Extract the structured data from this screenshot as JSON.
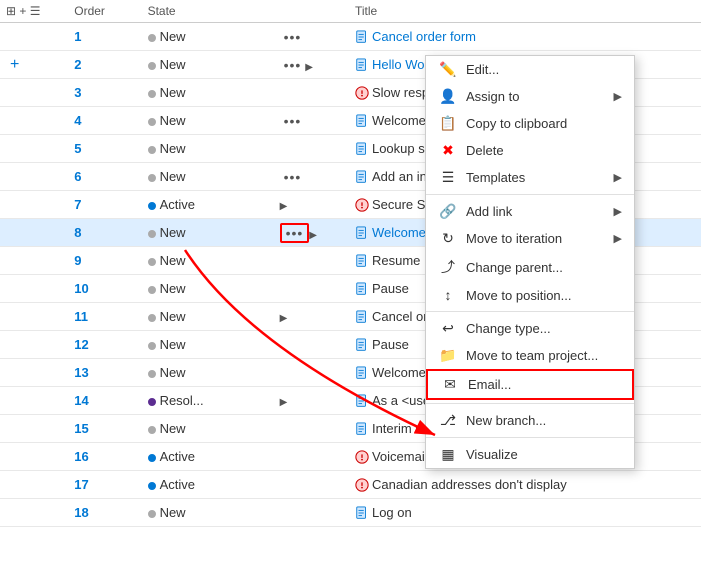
{
  "columns": [
    "",
    "Order",
    "State",
    "",
    "Title"
  ],
  "rows": [
    {
      "id": 1,
      "order": 1,
      "state": "New",
      "stateType": "new",
      "hasDots": true,
      "hasArrow": false,
      "hasChild": false,
      "iconType": "book",
      "title": "Cancel order form",
      "titleLink": true
    },
    {
      "id": 2,
      "order": 2,
      "state": "New",
      "stateType": "new",
      "hasDots": true,
      "hasArrow": true,
      "hasChild": false,
      "iconType": "book",
      "title": "Hello World web site",
      "titleLink": true,
      "addBtn": true
    },
    {
      "id": 3,
      "order": 3,
      "state": "New",
      "stateType": "new",
      "hasDots": false,
      "hasArrow": false,
      "hasChild": false,
      "iconType": "bug",
      "title": "Slow response on form",
      "titleLink": false
    },
    {
      "id": 4,
      "order": 4,
      "state": "New",
      "stateType": "new",
      "hasDots": true,
      "hasArrow": false,
      "hasChild": false,
      "iconType": "book",
      "title": "Welcome back page",
      "titleLink": false
    },
    {
      "id": 5,
      "order": 5,
      "state": "New",
      "stateType": "new",
      "hasDots": false,
      "hasArrow": false,
      "hasChild": false,
      "iconType": "book",
      "title": "Lookup service outages",
      "titleLink": false
    },
    {
      "id": 6,
      "order": 6,
      "state": "New",
      "stateType": "new",
      "hasDots": true,
      "hasArrow": false,
      "hasChild": false,
      "iconType": "book",
      "title": "Add an information form",
      "titleLink": false
    },
    {
      "id": 7,
      "order": 7,
      "state": "Active",
      "stateType": "active",
      "hasDots": false,
      "hasArrow": true,
      "hasChild": true,
      "iconType": "bug",
      "title": "Secure Sign-in",
      "titleLink": false
    },
    {
      "id": 8,
      "order": 8,
      "state": "New",
      "stateType": "new",
      "hasDots": true,
      "hasArrow": true,
      "hasChild": false,
      "iconType": "book",
      "title": "Welcome back",
      "titleLink": true,
      "highlighted": true,
      "dotsHighlighted": true
    },
    {
      "id": 9,
      "order": 9,
      "state": "New",
      "stateType": "new",
      "hasDots": false,
      "hasArrow": false,
      "hasChild": false,
      "iconType": "book",
      "title": "Resume",
      "titleLink": false
    },
    {
      "id": 10,
      "order": 10,
      "state": "New",
      "stateType": "new",
      "hasDots": false,
      "hasArrow": false,
      "hasChild": false,
      "iconType": "book",
      "title": "Pause",
      "titleLink": false
    },
    {
      "id": 11,
      "order": 11,
      "state": "New",
      "stateType": "new",
      "hasDots": false,
      "hasArrow": true,
      "hasChild": false,
      "iconType": "book",
      "title": "Cancel order form",
      "titleLink": false
    },
    {
      "id": 12,
      "order": 12,
      "state": "New",
      "stateType": "new",
      "hasDots": false,
      "hasArrow": false,
      "hasChild": false,
      "iconType": "book",
      "title": "Pause",
      "titleLink": false
    },
    {
      "id": 13,
      "order": 13,
      "state": "New",
      "stateType": "new",
      "hasDots": false,
      "hasArrow": false,
      "hasChild": false,
      "iconType": "book",
      "title": "Welcome back page",
      "titleLink": false
    },
    {
      "id": 14,
      "order": 14,
      "state": "Resol...",
      "stateType": "resolved",
      "hasDots": false,
      "hasArrow": true,
      "hasChild": false,
      "iconType": "book",
      "title": "As a <user>, I can select a numbe",
      "titleLink": false
    },
    {
      "id": 15,
      "order": 15,
      "state": "New",
      "stateType": "new",
      "hasDots": false,
      "hasArrow": false,
      "hasChild": false,
      "iconType": "book",
      "title": "Interim save on long forms",
      "titleLink": false
    },
    {
      "id": 16,
      "order": 16,
      "state": "Active",
      "stateType": "active",
      "hasDots": false,
      "hasArrow": false,
      "hasChild": false,
      "iconType": "bug",
      "title": "Voicemail hang issue",
      "titleLink": false
    },
    {
      "id": 17,
      "order": 17,
      "state": "Active",
      "stateType": "active",
      "hasDots": false,
      "hasArrow": false,
      "hasChild": false,
      "iconType": "bug",
      "title": "Canadian addresses don't display",
      "titleLink": false
    },
    {
      "id": 18,
      "order": 18,
      "state": "New",
      "stateType": "new",
      "hasDots": false,
      "hasArrow": false,
      "hasChild": false,
      "iconType": "book",
      "title": "Log on",
      "titleLink": false
    }
  ],
  "contextMenu": {
    "items": [
      {
        "id": "edit",
        "icon": "✏️",
        "label": "Edit...",
        "hasArrow": false
      },
      {
        "id": "assign",
        "icon": "👤",
        "label": "Assign to",
        "hasArrow": true
      },
      {
        "id": "copy",
        "icon": "📋",
        "label": "Copy to clipboard",
        "hasArrow": false
      },
      {
        "id": "delete",
        "icon": "✖",
        "label": "Delete",
        "hasArrow": false,
        "iconColor": "red"
      },
      {
        "id": "templates",
        "icon": "☰",
        "label": "Templates",
        "hasArrow": true
      },
      {
        "id": "divider1"
      },
      {
        "id": "addlink",
        "icon": "🔗",
        "label": "Add link",
        "hasArrow": true
      },
      {
        "id": "moveiteration",
        "icon": "↻",
        "label": "Move to iteration",
        "hasArrow": true
      },
      {
        "id": "changeparent",
        "icon": "⤴",
        "label": "Change parent...",
        "hasArrow": false
      },
      {
        "id": "moveposition",
        "icon": "↕",
        "label": "Move to position...",
        "hasArrow": false
      },
      {
        "id": "divider2"
      },
      {
        "id": "changetype",
        "icon": "↩",
        "label": "Change type...",
        "hasArrow": false
      },
      {
        "id": "movetoteam",
        "icon": "📁",
        "label": "Move to team project...",
        "hasArrow": false
      },
      {
        "id": "email",
        "icon": "✉",
        "label": "Email...",
        "hasArrow": false,
        "highlighted": true
      },
      {
        "id": "divider3"
      },
      {
        "id": "newbranch",
        "icon": "⎇",
        "label": "New branch...",
        "hasArrow": false
      },
      {
        "id": "divider4"
      },
      {
        "id": "visualize",
        "icon": "▦",
        "label": "Visualize",
        "hasArrow": false
      }
    ]
  }
}
